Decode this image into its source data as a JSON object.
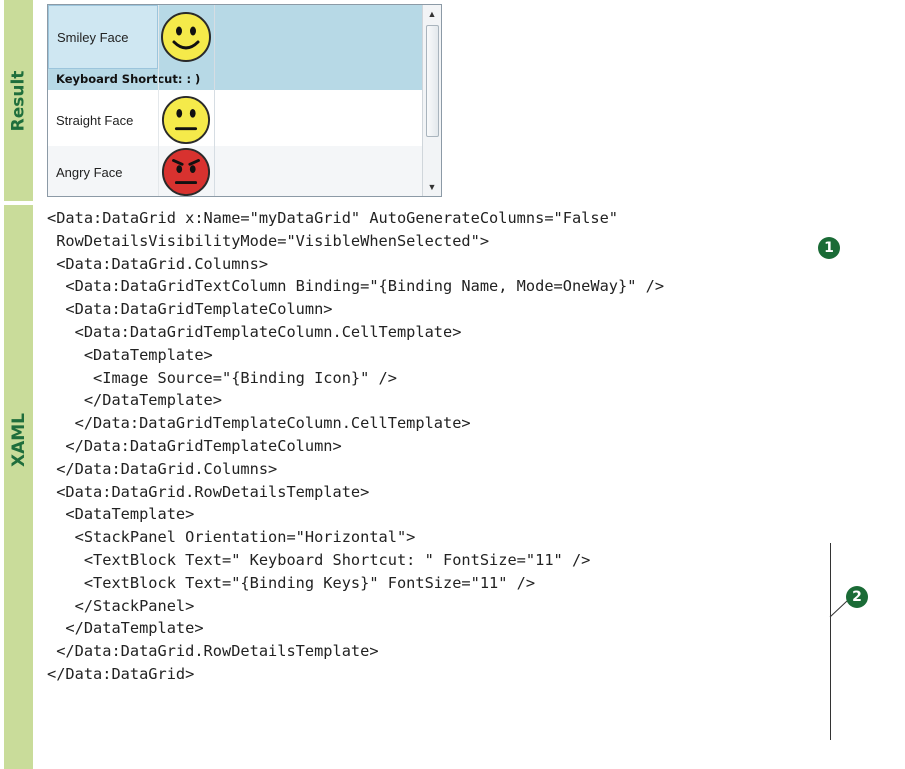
{
  "labels": {
    "result": "Result",
    "xaml": "XAML"
  },
  "grid": {
    "rows": [
      {
        "name": "Smiley Face",
        "icon": "smiley-face-icon",
        "selected": true,
        "details": "Keyboard Shortcut: : )"
      },
      {
        "name": "Straight Face",
        "icon": "straight-face-icon",
        "selected": false
      },
      {
        "name": "Angry Face",
        "icon": "angry-face-icon",
        "selected": false
      }
    ],
    "scroll_up": "▲",
    "scroll_down": "▼"
  },
  "code_lines": [
    "<Data:DataGrid x:Name=\"myDataGrid\" AutoGenerateColumns=\"False\"",
    " RowDetailsVisibilityMode=\"VisibleWhenSelected\">",
    " <Data:DataGrid.Columns>",
    "  <Data:DataGridTextColumn Binding=\"{Binding Name, Mode=OneWay}\" />",
    "  <Data:DataGridTemplateColumn>",
    "   <Data:DataGridTemplateColumn.CellTemplate>",
    "    <DataTemplate>",
    "     <Image Source=\"{Binding Icon}\" />",
    "    </DataTemplate>",
    "   </Data:DataGridTemplateColumn.CellTemplate>",
    "  </Data:DataGridTemplateColumn>",
    " </Data:DataGrid.Columns>",
    " <Data:DataGrid.RowDetailsTemplate>",
    "  <DataTemplate>",
    "   <StackPanel Orientation=\"Horizontal\">",
    "    <TextBlock Text=\" Keyboard Shortcut: \" FontSize=\"11\" />",
    "    <TextBlock Text=\"{Binding Keys}\" FontSize=\"11\" />",
    "   </StackPanel>",
    "  </DataTemplate>",
    " </Data:DataGrid.RowDetailsTemplate>",
    "</Data:DataGrid>"
  ],
  "callouts": [
    "1",
    "2"
  ],
  "colors": {
    "band": "#c9dc9a",
    "band_text": "#1f6e3c",
    "selected_row": "#b7d9e6",
    "callout": "#1a6b36"
  }
}
